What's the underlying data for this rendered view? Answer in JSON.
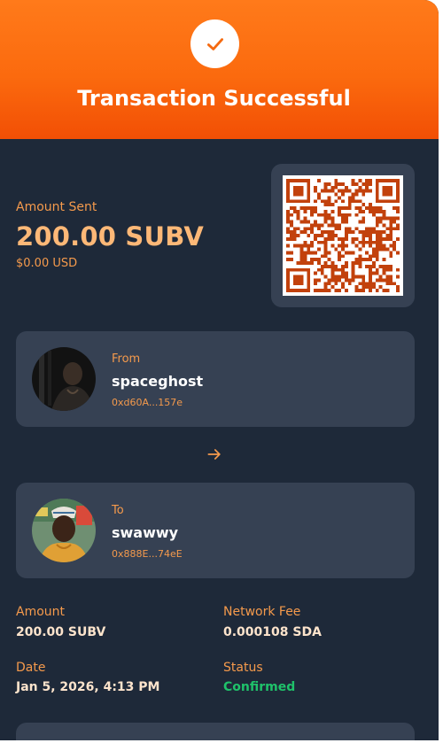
{
  "header": {
    "title": "Transaction Successful",
    "icon": "checkmark-icon",
    "gradient_start": "#ff7a1a",
    "gradient_end": "#f24f05"
  },
  "amount": {
    "label": "Amount Sent",
    "value": "200.00 SUBV",
    "usd": "$0.00 USD"
  },
  "from": {
    "label": "From",
    "name": "spaceghost",
    "address": "0xd60A...157e"
  },
  "to": {
    "label": "To",
    "name": "swawwy",
    "address": "0x888E...74eE"
  },
  "details": {
    "amount_label": "Amount",
    "amount_value": "200.00 SUBV",
    "fee_label": "Network Fee",
    "fee_value": "0.000108 SDA",
    "date_label": "Date",
    "date_value": "Jan 5, 2026, 4:13 PM",
    "status_label": "Status",
    "status_value": "Confirmed"
  },
  "colors": {
    "background": "#1e2939",
    "panel": "#364153",
    "accent": "#f59a4c",
    "qr": "#c2410c",
    "success": "#1fc26a"
  }
}
